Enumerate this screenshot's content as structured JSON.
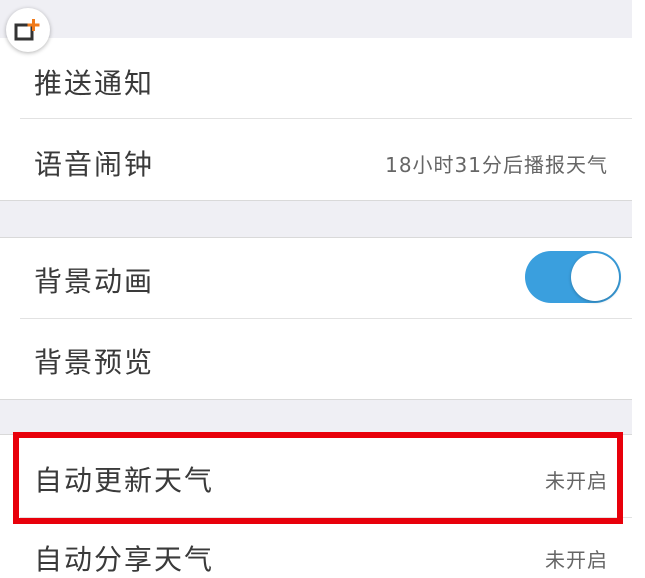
{
  "settings": {
    "items": [
      {
        "label": "推送通知",
        "value": ""
      },
      {
        "label": "语音闹钟",
        "value": "18小时31分后播报天气"
      },
      {
        "label": "背景动画",
        "value": ""
      },
      {
        "label": "背景预览",
        "value": ""
      },
      {
        "label": "自动更新天气",
        "value": "未开启"
      },
      {
        "label": "自动分享天气",
        "value": "未开启"
      }
    ],
    "background_animation_toggle": {
      "state": "on",
      "accent": "#3a9fde"
    }
  },
  "overlay": {
    "corner_icon": "share-plus-icon",
    "highlight_color": "#e8000b"
  },
  "colors": {
    "section_gap": "#efeff4",
    "toggle_on": "#3a9fde",
    "highlight": "#e8000b"
  }
}
